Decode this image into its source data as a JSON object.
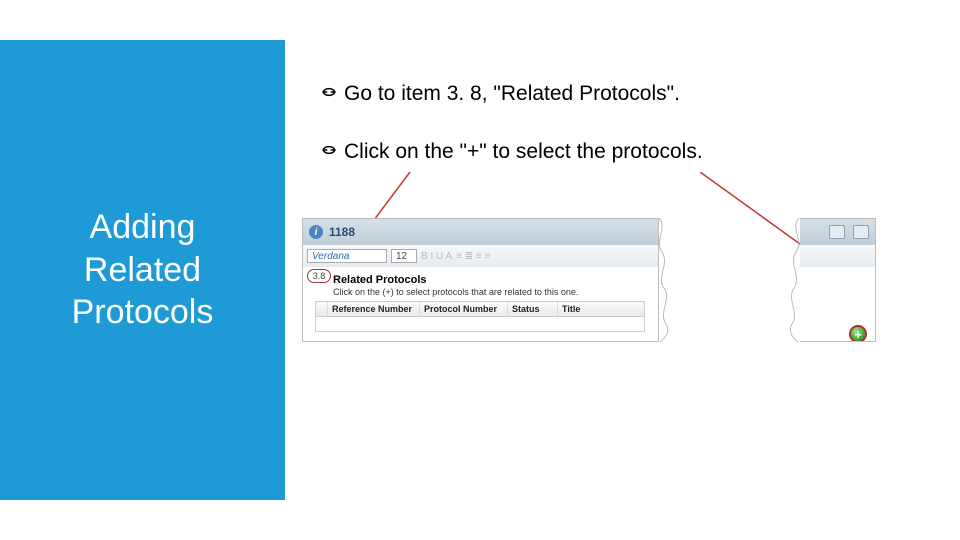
{
  "sidebar": {
    "title_line1": "Adding",
    "title_line2": "Related",
    "title_line3": "Protocols"
  },
  "bullets": [
    {
      "text": "Go to item 3. 8, \"Related Protocols\"."
    },
    {
      "text": "Click on the \"+\" to select the protocols."
    }
  ],
  "screenshot": {
    "topbar_number": "1188",
    "font_name": "Verdana",
    "font_size": "12",
    "format_buttons": "B  I  U  A",
    "section_number": "3.8",
    "section_title": "Related Protocols",
    "section_instruction": "Click on the (+) to select protocols that are related to this one.",
    "columns": {
      "c1": "",
      "c2": "Reference Number",
      "c3": "Protocol Number",
      "c4": "Status",
      "c5": "Title"
    },
    "add_glyph": "+"
  }
}
